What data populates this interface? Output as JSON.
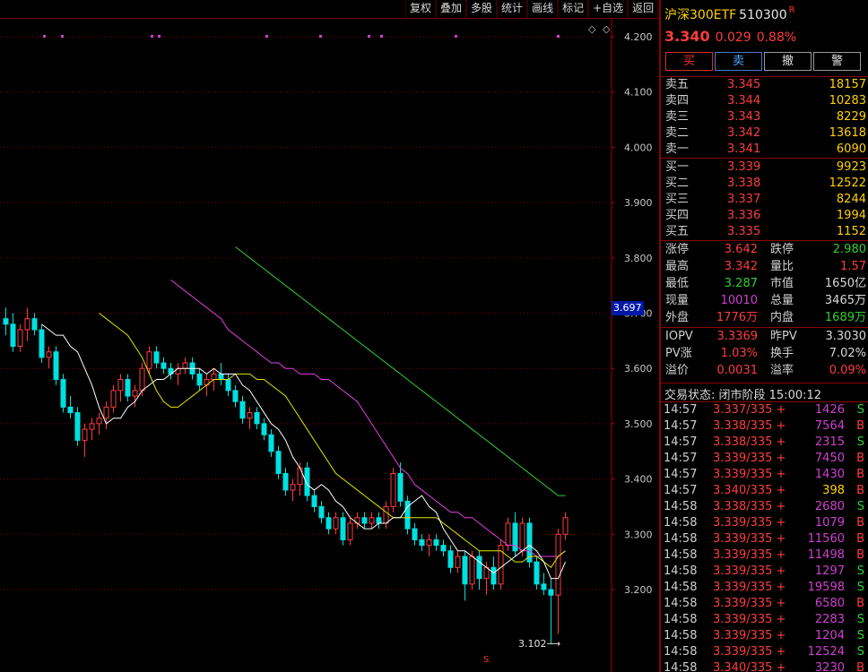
{
  "toolbar": [
    "复权",
    "叠加",
    "多股",
    "统计",
    "画线",
    "标记",
    "+自选",
    "返回"
  ],
  "chart": {
    "y_ticks": [
      "4.200",
      "4.100",
      "4.000",
      "3.900",
      "3.800",
      "3.700",
      "3.600",
      "3.500",
      "3.400",
      "3.300",
      "3.200"
    ],
    "current_price_marker": "3.697",
    "low_label": "3.102",
    "bottom_marker": "S",
    "diamond_icons": "◇",
    "colors": {
      "up": "#ff3c3c",
      "down": "#00e0e0",
      "ma5": "#ffffff",
      "ma10": "#e6e600",
      "ma20": "#e040e0",
      "ma60": "#30d030",
      "grid": "#8a0000"
    }
  },
  "chart_data": {
    "type": "candlestick",
    "y_range": [
      3.1,
      4.27
    ],
    "grid": true,
    "candles": [
      {
        "o": 3.69,
        "h": 3.71,
        "l": 3.66,
        "c": 3.68
      },
      {
        "o": 3.68,
        "h": 3.7,
        "l": 3.63,
        "c": 3.64
      },
      {
        "o": 3.64,
        "h": 3.68,
        "l": 3.63,
        "c": 3.67
      },
      {
        "o": 3.67,
        "h": 3.71,
        "l": 3.65,
        "c": 3.69
      },
      {
        "o": 3.69,
        "h": 3.7,
        "l": 3.66,
        "c": 3.67
      },
      {
        "o": 3.67,
        "h": 3.68,
        "l": 3.61,
        "c": 3.62
      },
      {
        "o": 3.62,
        "h": 3.64,
        "l": 3.6,
        "c": 3.63
      },
      {
        "o": 3.63,
        "h": 3.64,
        "l": 3.57,
        "c": 3.58
      },
      {
        "o": 3.58,
        "h": 3.59,
        "l": 3.52,
        "c": 3.53
      },
      {
        "o": 3.53,
        "h": 3.55,
        "l": 3.51,
        "c": 3.52
      },
      {
        "o": 3.52,
        "h": 3.53,
        "l": 3.46,
        "c": 3.47
      },
      {
        "o": 3.47,
        "h": 3.5,
        "l": 3.44,
        "c": 3.49
      },
      {
        "o": 3.49,
        "h": 3.51,
        "l": 3.47,
        "c": 3.5
      },
      {
        "o": 3.5,
        "h": 3.52,
        "l": 3.48,
        "c": 3.51
      },
      {
        "o": 3.51,
        "h": 3.54,
        "l": 3.49,
        "c": 3.53
      },
      {
        "o": 3.53,
        "h": 3.57,
        "l": 3.52,
        "c": 3.56
      },
      {
        "o": 3.56,
        "h": 3.59,
        "l": 3.54,
        "c": 3.58
      },
      {
        "o": 3.58,
        "h": 3.59,
        "l": 3.54,
        "c": 3.55
      },
      {
        "o": 3.55,
        "h": 3.57,
        "l": 3.53,
        "c": 3.56
      },
      {
        "o": 3.56,
        "h": 3.61,
        "l": 3.55,
        "c": 3.6
      },
      {
        "o": 3.6,
        "h": 3.64,
        "l": 3.59,
        "c": 3.63
      },
      {
        "o": 3.63,
        "h": 3.64,
        "l": 3.6,
        "c": 3.61
      },
      {
        "o": 3.61,
        "h": 3.62,
        "l": 3.59,
        "c": 3.6
      },
      {
        "o": 3.6,
        "h": 3.61,
        "l": 3.58,
        "c": 3.59
      },
      {
        "o": 3.59,
        "h": 3.61,
        "l": 3.57,
        "c": 3.6
      },
      {
        "o": 3.6,
        "h": 3.62,
        "l": 3.59,
        "c": 3.61
      },
      {
        "o": 3.61,
        "h": 3.62,
        "l": 3.58,
        "c": 3.59
      },
      {
        "o": 3.59,
        "h": 3.6,
        "l": 3.56,
        "c": 3.57
      },
      {
        "o": 3.57,
        "h": 3.59,
        "l": 3.55,
        "c": 3.58
      },
      {
        "o": 3.58,
        "h": 3.6,
        "l": 3.56,
        "c": 3.59
      },
      {
        "o": 3.59,
        "h": 3.61,
        "l": 3.57,
        "c": 3.58
      },
      {
        "o": 3.58,
        "h": 3.59,
        "l": 3.55,
        "c": 3.56
      },
      {
        "o": 3.56,
        "h": 3.57,
        "l": 3.53,
        "c": 3.54
      },
      {
        "o": 3.54,
        "h": 3.55,
        "l": 3.5,
        "c": 3.51
      },
      {
        "o": 3.51,
        "h": 3.53,
        "l": 3.49,
        "c": 3.52
      },
      {
        "o": 3.52,
        "h": 3.53,
        "l": 3.49,
        "c": 3.5
      },
      {
        "o": 3.5,
        "h": 3.51,
        "l": 3.47,
        "c": 3.48
      },
      {
        "o": 3.48,
        "h": 3.49,
        "l": 3.44,
        "c": 3.45
      },
      {
        "o": 3.45,
        "h": 3.46,
        "l": 3.4,
        "c": 3.41
      },
      {
        "o": 3.41,
        "h": 3.42,
        "l": 3.37,
        "c": 3.38
      },
      {
        "o": 3.38,
        "h": 3.4,
        "l": 3.36,
        "c": 3.39
      },
      {
        "o": 3.39,
        "h": 3.43,
        "l": 3.37,
        "c": 3.42
      },
      {
        "o": 3.42,
        "h": 3.43,
        "l": 3.36,
        "c": 3.37
      },
      {
        "o": 3.37,
        "h": 3.38,
        "l": 3.34,
        "c": 3.35
      },
      {
        "o": 3.35,
        "h": 3.36,
        "l": 3.32,
        "c": 3.33
      },
      {
        "o": 3.33,
        "h": 3.34,
        "l": 3.3,
        "c": 3.31
      },
      {
        "o": 3.31,
        "h": 3.34,
        "l": 3.3,
        "c": 3.33
      },
      {
        "o": 3.33,
        "h": 3.34,
        "l": 3.28,
        "c": 3.29
      },
      {
        "o": 3.29,
        "h": 3.33,
        "l": 3.28,
        "c": 3.32
      },
      {
        "o": 3.32,
        "h": 3.34,
        "l": 3.31,
        "c": 3.33
      },
      {
        "o": 3.33,
        "h": 3.34,
        "l": 3.31,
        "c": 3.32
      },
      {
        "o": 3.32,
        "h": 3.34,
        "l": 3.31,
        "c": 3.33
      },
      {
        "o": 3.33,
        "h": 3.34,
        "l": 3.31,
        "c": 3.32
      },
      {
        "o": 3.32,
        "h": 3.36,
        "l": 3.31,
        "c": 3.35
      },
      {
        "o": 3.35,
        "h": 3.42,
        "l": 3.34,
        "c": 3.41
      },
      {
        "o": 3.41,
        "h": 3.43,
        "l": 3.35,
        "c": 3.36
      },
      {
        "o": 3.36,
        "h": 3.37,
        "l": 3.3,
        "c": 3.31
      },
      {
        "o": 3.31,
        "h": 3.32,
        "l": 3.28,
        "c": 3.29
      },
      {
        "o": 3.29,
        "h": 3.3,
        "l": 3.27,
        "c": 3.28
      },
      {
        "o": 3.28,
        "h": 3.3,
        "l": 3.26,
        "c": 3.29
      },
      {
        "o": 3.29,
        "h": 3.3,
        "l": 3.27,
        "c": 3.28
      },
      {
        "o": 3.28,
        "h": 3.29,
        "l": 3.26,
        "c": 3.27
      },
      {
        "o": 3.27,
        "h": 3.28,
        "l": 3.23,
        "c": 3.24
      },
      {
        "o": 3.24,
        "h": 3.27,
        "l": 3.23,
        "c": 3.26
      },
      {
        "o": 3.26,
        "h": 3.27,
        "l": 3.18,
        "c": 3.21
      },
      {
        "o": 3.21,
        "h": 3.27,
        "l": 3.2,
        "c": 3.26
      },
      {
        "o": 3.26,
        "h": 3.27,
        "l": 3.2,
        "c": 3.22
      },
      {
        "o": 3.22,
        "h": 3.25,
        "l": 3.19,
        "c": 3.24
      },
      {
        "o": 3.24,
        "h": 3.26,
        "l": 3.2,
        "c": 3.21
      },
      {
        "o": 3.21,
        "h": 3.29,
        "l": 3.2,
        "c": 3.28
      },
      {
        "o": 3.28,
        "h": 3.33,
        "l": 3.27,
        "c": 3.32
      },
      {
        "o": 3.32,
        "h": 3.34,
        "l": 3.26,
        "c": 3.27
      },
      {
        "o": 3.27,
        "h": 3.33,
        "l": 3.26,
        "c": 3.32
      },
      {
        "o": 3.32,
        "h": 3.33,
        "l": 3.24,
        "c": 3.25
      },
      {
        "o": 3.25,
        "h": 3.26,
        "l": 3.2,
        "c": 3.21
      },
      {
        "o": 3.21,
        "h": 3.23,
        "l": 3.19,
        "c": 3.2
      },
      {
        "o": 3.2,
        "h": 3.22,
        "l": 3.102,
        "c": 3.19
      },
      {
        "o": 3.19,
        "h": 3.31,
        "l": 3.12,
        "c": 3.3
      },
      {
        "o": 3.3,
        "h": 3.34,
        "l": 3.29,
        "c": 3.33
      }
    ],
    "ma5": [
      3.68,
      3.67,
      3.66,
      3.66,
      3.64,
      3.63,
      3.6,
      3.57,
      3.53,
      3.5,
      3.51,
      3.51,
      3.53,
      3.54,
      3.56,
      3.57,
      3.58,
      3.58,
      3.59,
      3.6,
      3.6,
      3.6,
      3.6,
      3.59,
      3.6,
      3.59,
      3.59,
      3.59,
      3.57,
      3.56,
      3.54,
      3.52,
      3.5,
      3.49,
      3.47,
      3.44,
      3.42,
      3.39,
      3.38,
      3.39,
      3.38,
      3.36,
      3.35,
      3.33,
      3.32,
      3.31,
      3.31,
      3.32,
      3.32,
      3.33,
      3.33,
      3.35,
      3.36,
      3.37,
      3.35,
      3.34,
      3.31,
      3.29,
      3.27,
      3.27,
      3.26,
      3.25,
      3.24,
      3.23,
      3.24,
      3.25,
      3.26,
      3.27,
      3.28,
      3.27,
      3.25,
      3.22,
      3.22,
      3.25
    ],
    "ma10": [
      3.7,
      3.69,
      3.68,
      3.67,
      3.66,
      3.64,
      3.62,
      3.59,
      3.56,
      3.54,
      3.53,
      3.53,
      3.54,
      3.55,
      3.56,
      3.57,
      3.58,
      3.58,
      3.58,
      3.59,
      3.59,
      3.59,
      3.58,
      3.58,
      3.57,
      3.56,
      3.55,
      3.53,
      3.51,
      3.49,
      3.47,
      3.45,
      3.43,
      3.41,
      3.4,
      3.39,
      3.38,
      3.37,
      3.36,
      3.35,
      3.34,
      3.33,
      3.33,
      3.33,
      3.33,
      3.33,
      3.33,
      3.33,
      3.32,
      3.31,
      3.3,
      3.29,
      3.28,
      3.27,
      3.27,
      3.27,
      3.27,
      3.26,
      3.25,
      3.25,
      3.26,
      3.26,
      3.25,
      3.24,
      3.26,
      3.27
    ],
    "ma20": [
      3.76,
      3.75,
      3.74,
      3.73,
      3.72,
      3.71,
      3.7,
      3.69,
      3.67,
      3.66,
      3.65,
      3.64,
      3.63,
      3.62,
      3.61,
      3.61,
      3.6,
      3.6,
      3.59,
      3.59,
      3.59,
      3.58,
      3.58,
      3.57,
      3.56,
      3.55,
      3.54,
      3.52,
      3.5,
      3.48,
      3.46,
      3.44,
      3.42,
      3.41,
      3.39,
      3.38,
      3.37,
      3.36,
      3.35,
      3.34,
      3.34,
      3.33,
      3.33,
      3.32,
      3.31,
      3.3,
      3.29,
      3.28,
      3.28,
      3.27,
      3.27,
      3.26,
      3.26,
      3.26,
      3.26,
      3.27
    ],
    "ma60": [
      3.82,
      3.81,
      3.8,
      3.79,
      3.78,
      3.77,
      3.76,
      3.75,
      3.74,
      3.73,
      3.72,
      3.71,
      3.7,
      3.69,
      3.68,
      3.67,
      3.66,
      3.65,
      3.64,
      3.63,
      3.62,
      3.61,
      3.6,
      3.59,
      3.58,
      3.57,
      3.56,
      3.55,
      3.54,
      3.53,
      3.52,
      3.51,
      3.5,
      3.49,
      3.48,
      3.47,
      3.46,
      3.45,
      3.44,
      3.43,
      3.42,
      3.41,
      3.4,
      3.39,
      3.38,
      3.37,
      3.37
    ]
  },
  "panel": {
    "title": "沪深300ETF",
    "code": "510300",
    "flag": "R",
    "last": "3.340",
    "change": "0.029",
    "change_pct": "0.88%",
    "buttons": [
      "买",
      "卖",
      "撤",
      "警"
    ],
    "asks": [
      {
        "label": "卖五",
        "price": "3.345",
        "vol": "18157"
      },
      {
        "label": "卖四",
        "price": "3.344",
        "vol": "10283"
      },
      {
        "label": "卖三",
        "price": "3.343",
        "vol": "8229"
      },
      {
        "label": "卖二",
        "price": "3.342",
        "vol": "13618"
      },
      {
        "label": "卖一",
        "price": "3.341",
        "vol": "6090"
      }
    ],
    "bids": [
      {
        "label": "买一",
        "price": "3.339",
        "vol": "9923"
      },
      {
        "label": "买二",
        "price": "3.338",
        "vol": "12522"
      },
      {
        "label": "买三",
        "price": "3.337",
        "vol": "8244"
      },
      {
        "label": "买四",
        "price": "3.336",
        "vol": "1994"
      },
      {
        "label": "买五",
        "price": "3.335",
        "vol": "1152"
      }
    ],
    "stats": [
      {
        "l1": "涨停",
        "v1": "3.642",
        "c1": "#ff3c3c",
        "l2": "跌停",
        "v2": "2.980",
        "c2": "#30d030"
      },
      {
        "l1": "最高",
        "v1": "3.342",
        "c1": "#ff3c3c",
        "l2": "量比",
        "v2": "1.57",
        "c2": "#ff3c3c"
      },
      {
        "l1": "最低",
        "v1": "3.287",
        "c1": "#30d030",
        "l2": "市值",
        "v2": "1650亿",
        "c2": "#d8d8d8"
      },
      {
        "l1": "现量",
        "v1": "10010",
        "c1": "#d040d0",
        "l2": "总量",
        "v2": "3465万",
        "c2": "#d8d8d8"
      },
      {
        "l1": "外盘",
        "v1": "1776万",
        "c1": "#ff3c3c",
        "l2": "内盘",
        "v2": "1689万",
        "c2": "#30d030"
      }
    ],
    "iopv": [
      {
        "l1": "IOPV",
        "v1": "3.3369",
        "c1": "#ff3c3c",
        "l2": "昨PV",
        "v2": "3.3030",
        "c2": "#d8d8d8"
      },
      {
        "l1": "PV涨",
        "v1": "1.03%",
        "c1": "#ff3c3c",
        "l2": "换手",
        "v2": "7.02%",
        "c2": "#d8d8d8"
      },
      {
        "l1": "溢价",
        "v1": "0.0031",
        "c1": "#ff3c3c",
        "l2": "溢率",
        "v2": "0.09%",
        "c2": "#ff3c3c"
      }
    ],
    "trade_status": "交易状态: 闭市阶段 15:00:12",
    "ticks": [
      {
        "time": "14:57",
        "price": "3.337/335 +",
        "vol": "1426",
        "side": "S",
        "vc": "#d040d0",
        "sc": "#30d030"
      },
      {
        "time": "14:57",
        "price": "3.338/335 +",
        "vol": "7564",
        "side": "B",
        "vc": "#d040d0",
        "sc": "#ff3c3c"
      },
      {
        "time": "14:57",
        "price": "3.338/335 +",
        "vol": "2315",
        "side": "S",
        "vc": "#d040d0",
        "sc": "#30d030"
      },
      {
        "time": "14:57",
        "price": "3.339/335 +",
        "vol": "7450",
        "side": "B",
        "vc": "#d040d0",
        "sc": "#ff3c3c"
      },
      {
        "time": "14:57",
        "price": "3.339/335 +",
        "vol": "1430",
        "side": "B",
        "vc": "#d040d0",
        "sc": "#ff3c3c"
      },
      {
        "time": "14:57",
        "price": "3.340/335 +",
        "vol": "398",
        "side": "B",
        "vc": "#ffd200",
        "sc": "#ff3c3c"
      },
      {
        "time": "14:58",
        "price": "3.338/335 +",
        "vol": "2680",
        "side": "S",
        "vc": "#d040d0",
        "sc": "#30d030"
      },
      {
        "time": "14:58",
        "price": "3.339/335 +",
        "vol": "1079",
        "side": "B",
        "vc": "#d040d0",
        "sc": "#ff3c3c"
      },
      {
        "time": "14:58",
        "price": "3.339/335 +",
        "vol": "11560",
        "side": "B",
        "vc": "#d040d0",
        "sc": "#ff3c3c"
      },
      {
        "time": "14:58",
        "price": "3.339/335 +",
        "vol": "11498",
        "side": "B",
        "vc": "#d040d0",
        "sc": "#ff3c3c"
      },
      {
        "time": "14:58",
        "price": "3.339/335 +",
        "vol": "1297",
        "side": "S",
        "vc": "#d040d0",
        "sc": "#30d030"
      },
      {
        "time": "14:58",
        "price": "3.339/335 +",
        "vol": "19598",
        "side": "S",
        "vc": "#d040d0",
        "sc": "#30d030"
      },
      {
        "time": "14:58",
        "price": "3.339/335 +",
        "vol": "6580",
        "side": "B",
        "vc": "#d040d0",
        "sc": "#ff3c3c"
      },
      {
        "time": "14:58",
        "price": "3.339/335 +",
        "vol": "2283",
        "side": "S",
        "vc": "#d040d0",
        "sc": "#30d030"
      },
      {
        "time": "14:58",
        "price": "3.339/335 +",
        "vol": "1204",
        "side": "S",
        "vc": "#d040d0",
        "sc": "#30d030"
      },
      {
        "time": "14:58",
        "price": "3.339/335 +",
        "vol": "12524",
        "side": "S",
        "vc": "#d040d0",
        "sc": "#30d030"
      },
      {
        "time": "14:58",
        "price": "3.340/335 +",
        "vol": "3230",
        "side": "B",
        "vc": "#d040d0",
        "sc": "#ff3c3c"
      }
    ]
  }
}
